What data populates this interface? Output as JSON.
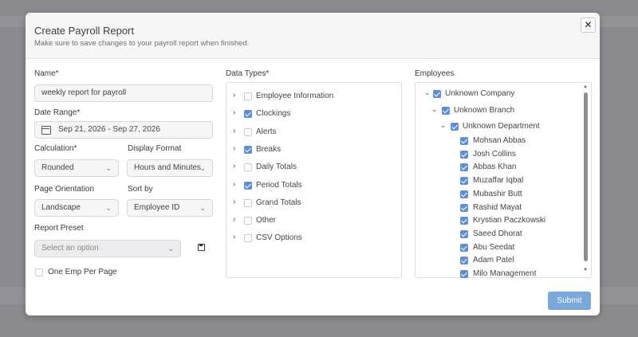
{
  "dialog": {
    "title": "Create Payroll Report",
    "subtitle": "Make sure to save changes to your payroll report when finished.",
    "close_glyph": "✕"
  },
  "form": {
    "name_label": "Name*",
    "name_value": "weekly report for payroll",
    "date_range_label": "Date Range*",
    "date_range_value": "Sep 21, 2026 - Sep 27, 2026",
    "calculation_label": "Calculation*",
    "calculation_value": "Rounded",
    "display_format_label": "Display Format",
    "display_format_value": "Hours and Minutes",
    "page_orientation_label": "Page Orientation",
    "page_orientation_value": "Landscape",
    "sort_by_label": "Sort by",
    "sort_by_value": "Employee ID",
    "report_preset_label": "Report Preset",
    "report_preset_placeholder": "Select an option",
    "one_emp_per_page_label": "One Emp Per Page",
    "one_emp_per_page_checked": false
  },
  "data_types": {
    "label": "Data Types*",
    "items": [
      {
        "label": "Employee Information",
        "checked": false
      },
      {
        "label": "Clockings",
        "checked": true
      },
      {
        "label": "Alerts",
        "checked": false
      },
      {
        "label": "Breaks",
        "checked": true
      },
      {
        "label": "Daily Totals",
        "checked": false
      },
      {
        "label": "Period Totals",
        "checked": true
      },
      {
        "label": "Grand Totals",
        "checked": false
      },
      {
        "label": "Other",
        "checked": false
      },
      {
        "label": "CSV Options",
        "checked": false
      }
    ]
  },
  "employees": {
    "label": "Employees",
    "company": "Unknown Company",
    "branch": "Unknown Branch",
    "department": "Unknown Department",
    "people": [
      "Mohsan Abbas",
      "Josh Collins",
      "Abbas Khan",
      "Muzaffar Iqbal",
      "Mubashir Butt",
      "Rashid Mayat",
      "Krystian Paczkowski",
      "Saeed Dhorat",
      "Abu Seedat",
      "Adam Patel",
      "Milo Management"
    ]
  },
  "submit_label": "Submit",
  "colors": {
    "accent": "#5b8fd6",
    "submit": "#7aa7dc",
    "overlay": "#8b8b8d"
  },
  "icons": {
    "calendar": "calendar-icon",
    "save": "save-icon",
    "close": "close-icon",
    "chevron": "chevron-down-icon"
  }
}
